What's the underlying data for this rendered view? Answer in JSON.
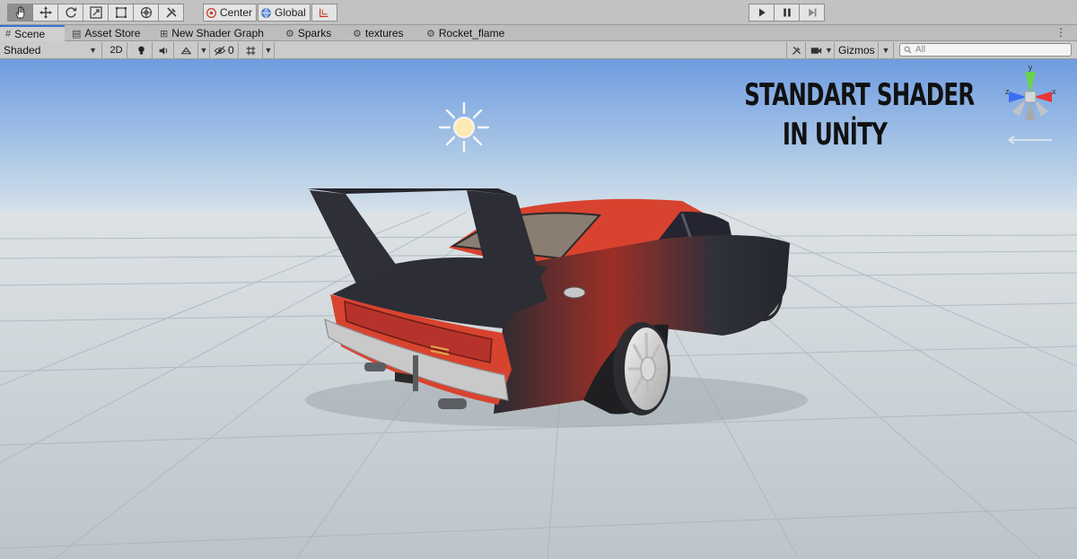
{
  "toolbar": {
    "tools": [
      {
        "name": "hand-tool",
        "icon": "hand-icon",
        "active": true
      },
      {
        "name": "move-tool",
        "icon": "move-icon"
      },
      {
        "name": "rotate-tool",
        "icon": "rotate-icon"
      },
      {
        "name": "scale-tool",
        "icon": "scale-icon"
      },
      {
        "name": "rect-tool",
        "icon": "rect-transform-icon"
      },
      {
        "name": "transform-tool",
        "icon": "transform-icon"
      },
      {
        "name": "custom-tool",
        "icon": "tools-icon"
      }
    ],
    "pivot_label": "Center",
    "space_label": "Global",
    "snap_icon": "grid-snap-icon",
    "play_icon": "play-icon",
    "pause_icon": "pause-icon",
    "step_icon": "step-icon"
  },
  "tabs": [
    {
      "label": "Scene",
      "icon": "grid-icon",
      "active": true
    },
    {
      "label": "Asset Store",
      "icon": "store-icon"
    },
    {
      "label": "New Shader Graph",
      "icon": "graph-icon"
    },
    {
      "label": "Sparks",
      "icon": "shader-icon"
    },
    {
      "label": "textures",
      "icon": "shader-icon"
    },
    {
      "label": "Rocket_flame",
      "icon": "shader-icon"
    }
  ],
  "scenebar": {
    "draw_mode": "Shaded",
    "mode_2d": "2D",
    "hidden_count": "0",
    "gizmos_label": "Gizmos",
    "search_placeholder": "All"
  },
  "overlay": {
    "line1": "STANDART SHADER",
    "line2": "IN UNİTY"
  },
  "colors": {
    "accent": "#3a72d8",
    "car_body": "#d9412e",
    "sky_top": "#6f9ce0",
    "ground": "#c3ccd2"
  }
}
